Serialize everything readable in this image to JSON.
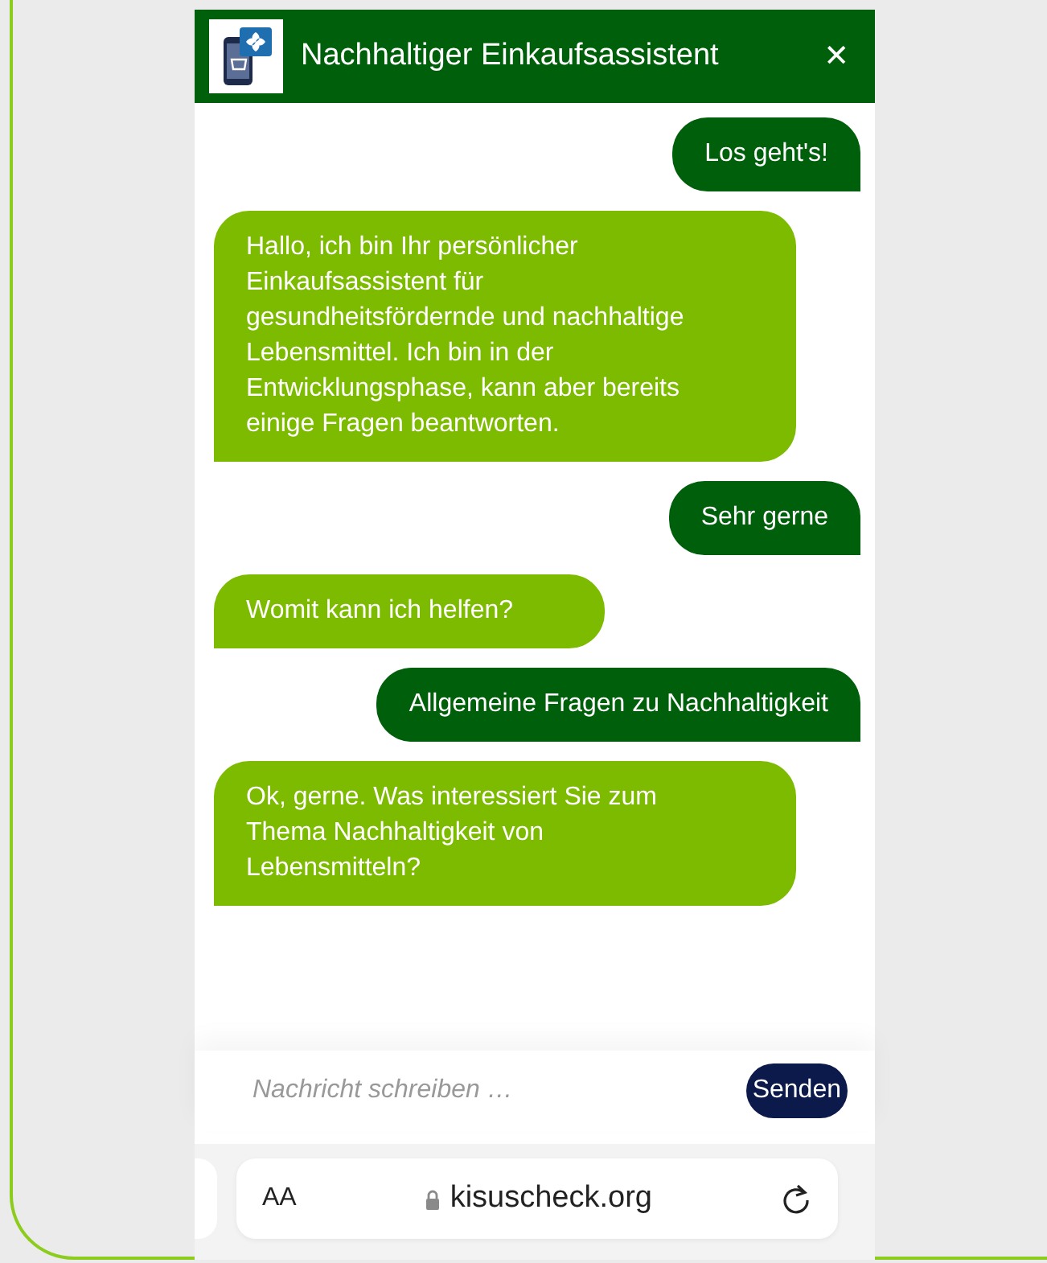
{
  "header": {
    "title": "Nachhaltiger Einkaufsassistent",
    "close": "✕"
  },
  "messages": [
    {
      "kind": "user",
      "text": "Los geht's!"
    },
    {
      "kind": "bot",
      "text": "Hallo, ich bin Ihr persönlicher Einkaufsassistent für gesundheitsfördernde und nachhaltige Lebensmittel. Ich bin in der Entwicklungsphase, kann aber bereits einige Fragen beantworten."
    },
    {
      "kind": "user",
      "text": "Sehr gerne"
    },
    {
      "kind": "bot",
      "text": "Womit kann ich helfen?"
    },
    {
      "kind": "user",
      "text": "Allgemeine Fragen zu Nachhaltigkeit"
    },
    {
      "kind": "bot",
      "text": "Ok, gerne. Was interessiert Sie zum Thema Nachhaltigkeit von Lebensmitteln?"
    }
  ],
  "composer": {
    "placeholder": "Nachricht schreiben …",
    "send": "Senden"
  },
  "browser": {
    "text_size": "AA",
    "url": "kisuscheck.org"
  }
}
